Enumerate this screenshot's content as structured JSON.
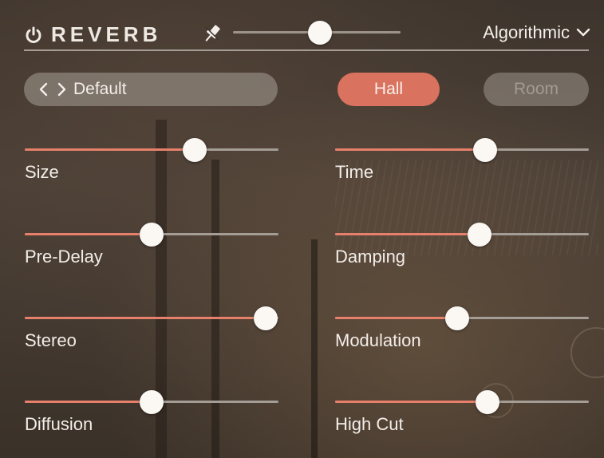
{
  "header": {
    "title": "REVERB",
    "mode": "Algorithmic",
    "master_level": 0.52
  },
  "preset": {
    "name": "Default"
  },
  "types": {
    "hall": "Hall",
    "room": "Room",
    "selected": "Hall"
  },
  "colors": {
    "accent": "#e6806b",
    "accent_button": "#d9725f",
    "track": "#a49d96",
    "thumb": "#fbf7f3"
  },
  "icons": {
    "power": "power-icon",
    "pin": "pin-icon",
    "chevron": "chevron-down-icon",
    "prev": "chevron-left-icon",
    "next": "chevron-right-icon"
  },
  "sliders": {
    "size": {
      "label": "Size",
      "value": 0.67
    },
    "time": {
      "label": "Time",
      "value": 0.59
    },
    "predelay": {
      "label": "Pre-Delay",
      "value": 0.5
    },
    "damping": {
      "label": "Damping",
      "value": 0.57
    },
    "stereo": {
      "label": "Stereo",
      "value": 0.95
    },
    "modulation": {
      "label": "Modulation",
      "value": 0.48
    },
    "diffusion": {
      "label": "Diffusion",
      "value": 0.5
    },
    "highcut": {
      "label": "High Cut",
      "value": 0.6
    }
  }
}
